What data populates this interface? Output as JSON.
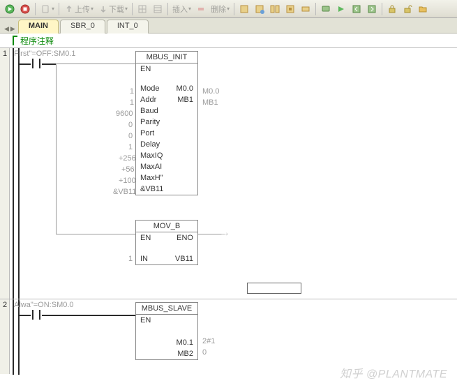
{
  "toolbar": {
    "upload": "上传",
    "download": "下载",
    "insert": "插入",
    "delete": "删除"
  },
  "tabs": {
    "active": "MAIN",
    "sbr": "SBR_0",
    "int": "INT_0"
  },
  "comment": "程序注释",
  "net1": {
    "num": "1",
    "contact_label": "First\"=OFF:SM0.1",
    "block1": {
      "title": "MBUS_INIT",
      "rows": [
        {
          "inval": "",
          "in": "EN",
          "out": "",
          "outval": ""
        },
        {
          "inval": "1",
          "in": "Mode",
          "out": "M0.0",
          "outval": "M0.0"
        },
        {
          "inval": "1",
          "in": "Addr",
          "out": "MB1",
          "outval": "MB1"
        },
        {
          "inval": "9600",
          "in": "Baud",
          "out": "",
          "outval": ""
        },
        {
          "inval": "0",
          "in": "Parity",
          "out": "",
          "outval": ""
        },
        {
          "inval": "0",
          "in": "Port",
          "out": "",
          "outval": ""
        },
        {
          "inval": "1",
          "in": "Delay",
          "out": "",
          "outval": ""
        },
        {
          "inval": "+256",
          "in": "MaxIQ",
          "out": "",
          "outval": ""
        },
        {
          "inval": "+56",
          "in": "MaxAI",
          "out": "",
          "outval": ""
        },
        {
          "inval": "+100",
          "in": "MaxH\"",
          "out": "",
          "outval": ""
        },
        {
          "inval": "&VB11",
          "in": "&VB11",
          "out": "",
          "outval": ""
        }
      ]
    },
    "block2": {
      "title": "MOV_B",
      "en": "EN",
      "eno": "ENO",
      "in_val": "1",
      "in": "IN",
      "out": "VB11"
    }
  },
  "net2": {
    "num": "2",
    "contact_label": "Alwa\"=ON:SM0.0",
    "block": {
      "title": "MBUS_SLAVE",
      "en": "EN",
      "out1": "M0.1",
      "out1val": "2#1",
      "out2": "MB2",
      "out2val": "0"
    }
  },
  "watermark": "知乎 @PLANTMATE"
}
